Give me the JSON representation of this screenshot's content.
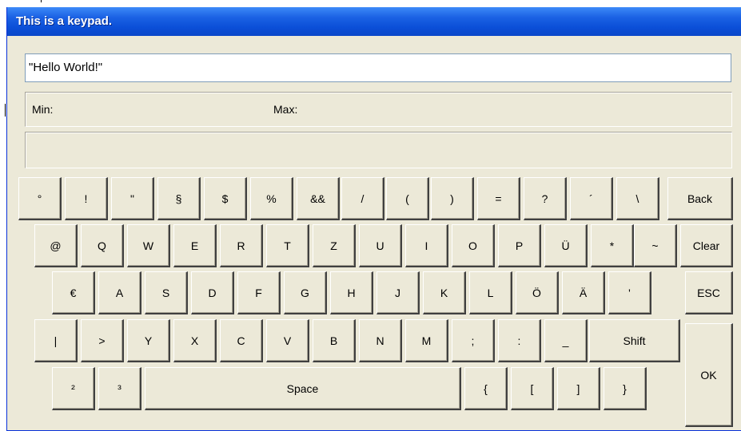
{
  "window": {
    "title": "This is a keypad."
  },
  "input": {
    "value": "\"Hello World!\""
  },
  "limits": {
    "min_label": "Min:",
    "max_label": "Max:"
  },
  "keys": {
    "row1": [
      "°",
      "!",
      "\"",
      "§",
      "$",
      "%",
      "&&",
      "/",
      "(",
      ")",
      "=",
      "?",
      "´",
      "\\"
    ],
    "row2": [
      "@",
      "Q",
      "W",
      "E",
      "R",
      "T",
      "Z",
      "U",
      "I",
      "O",
      "P",
      "Ü",
      "*",
      "~"
    ],
    "row3": [
      "€",
      "A",
      "S",
      "D",
      "F",
      "G",
      "H",
      "J",
      "K",
      "L",
      "Ö",
      "Ä",
      "'"
    ],
    "row4": [
      "|",
      ">",
      "Y",
      "X",
      "C",
      "V",
      "B",
      "N",
      "M",
      ";",
      ":",
      "_"
    ],
    "row5_left": [
      "²",
      "³"
    ],
    "row5_right": [
      "{",
      "[",
      "]",
      "}"
    ],
    "shift": "Shift",
    "space": "Space",
    "back": "Back",
    "clear": "Clear",
    "esc": "ESC",
    "ok": "OK"
  }
}
